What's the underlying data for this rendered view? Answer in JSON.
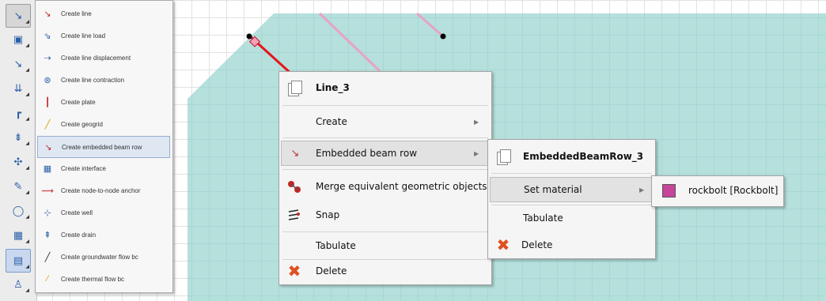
{
  "toolbar": {
    "tools": [
      {
        "name": "line-tool-icon",
        "glyph": "↘",
        "state": "active"
      },
      {
        "name": "soil-polygon-tool-icon",
        "glyph": "▣",
        "state": "normal"
      },
      {
        "name": "point-load-tool-icon",
        "glyph": "↘",
        "state": "normal"
      },
      {
        "name": "line-load-tool-icon",
        "glyph": "⇊",
        "state": "normal"
      },
      {
        "name": "plate-tool-icon",
        "glyph": "┏",
        "state": "normal"
      },
      {
        "name": "distributed-load-tool-icon",
        "glyph": "⇟",
        "state": "normal"
      },
      {
        "name": "displacement-tool-icon",
        "glyph": "✣",
        "state": "normal"
      },
      {
        "name": "pencil-tool-icon",
        "glyph": "✎",
        "state": "normal"
      },
      {
        "name": "tunnel-tool-icon",
        "glyph": "◯",
        "state": "normal"
      },
      {
        "name": "drain-tool-icon",
        "glyph": "▦",
        "state": "normal"
      },
      {
        "name": "table-tool-icon",
        "glyph": "▤",
        "state": "selected"
      },
      {
        "name": "flow-tool-icon",
        "glyph": "♙",
        "state": "normal"
      }
    ]
  },
  "line_flyout": {
    "items": [
      {
        "name": "create-line",
        "label": "Create line",
        "icon": "line-icon",
        "glyph": "↘",
        "color": "#c03030"
      },
      {
        "name": "create-line-load",
        "label": "Create line load",
        "icon": "line-load-icon",
        "glyph": "⇘",
        "color": "#2b5fa8"
      },
      {
        "name": "create-line-displacement",
        "label": "Create line displacement",
        "icon": "line-displacement-icon",
        "glyph": "⇢",
        "color": "#2b5fa8"
      },
      {
        "name": "create-line-contraction",
        "label": "Create line contraction",
        "icon": "line-contraction-icon",
        "glyph": "⊛",
        "color": "#2b5fa8"
      },
      {
        "name": "create-plate",
        "label": "Create plate",
        "icon": "plate-icon",
        "glyph": "┃",
        "color": "#c03030"
      },
      {
        "name": "create-geogrid",
        "label": "Create geogrid",
        "icon": "geogrid-icon",
        "glyph": "╱",
        "color": "#c9a400"
      },
      {
        "name": "create-embedded-beam-row",
        "label": "Create embedded beam row",
        "icon": "embedded-beam-row-icon",
        "glyph": "↘",
        "color": "#c03030"
      },
      {
        "name": "create-interface",
        "label": "Create interface",
        "icon": "interface-icon",
        "glyph": "▦",
        "color": "#2b5fa8"
      },
      {
        "name": "create-node-to-node-anchor",
        "label": "Create node-to-node anchor",
        "icon": "anchor-icon",
        "glyph": "⟿",
        "color": "#c03030"
      },
      {
        "name": "create-well",
        "label": "Create well",
        "icon": "well-icon",
        "glyph": "⊹",
        "color": "#2b5fa8"
      },
      {
        "name": "create-drain",
        "label": "Create drain",
        "icon": "drain-icon",
        "glyph": "⇞",
        "color": "#2b5fa8"
      },
      {
        "name": "create-groundwater-flow-bc",
        "label": "Create groundwater flow bc",
        "icon": "groundwater-flow-bc-icon",
        "glyph": "╱",
        "color": "#222222"
      },
      {
        "name": "create-thermal-flow-bc",
        "label": "Create thermal flow bc",
        "icon": "thermal-flow-bc-icon",
        "glyph": "⁄",
        "color": "#d49a00"
      }
    ]
  },
  "context_menu": {
    "header": "Line_3",
    "items": [
      {
        "name": "create",
        "label": "Create",
        "submenu": true
      },
      {
        "name": "embedded-beam-row",
        "label": "Embedded beam row",
        "submenu": true
      },
      {
        "name": "merge-equivalent-geometric-objects",
        "label": "Merge equivalent geometric objects",
        "submenu": false
      },
      {
        "name": "snap",
        "label": "Snap",
        "submenu": false
      },
      {
        "name": "tabulate",
        "label": "Tabulate",
        "submenu": false
      },
      {
        "name": "delete",
        "label": "Delete",
        "submenu": false
      }
    ]
  },
  "embedded_submenu": {
    "header": "EmbeddedBeamRow_3",
    "items": [
      {
        "name": "set-material",
        "label": "Set material",
        "submenu": true
      },
      {
        "name": "tabulate",
        "label": "Tabulate",
        "submenu": false
      },
      {
        "name": "delete",
        "label": "Delete",
        "submenu": false
      }
    ]
  },
  "material_submenu": {
    "items": [
      {
        "name": "rockbolt",
        "label": "rockbolt [Rockbolt]",
        "color": "#c8449a"
      }
    ]
  },
  "colors": {
    "soil": "#b5e0dc",
    "soil_grid": "#9ccfcb",
    "selected_line": "#e8141c",
    "other_line": "#e8a3c4",
    "menu_hover": "#e2e2e2",
    "delete": "#e05020"
  }
}
